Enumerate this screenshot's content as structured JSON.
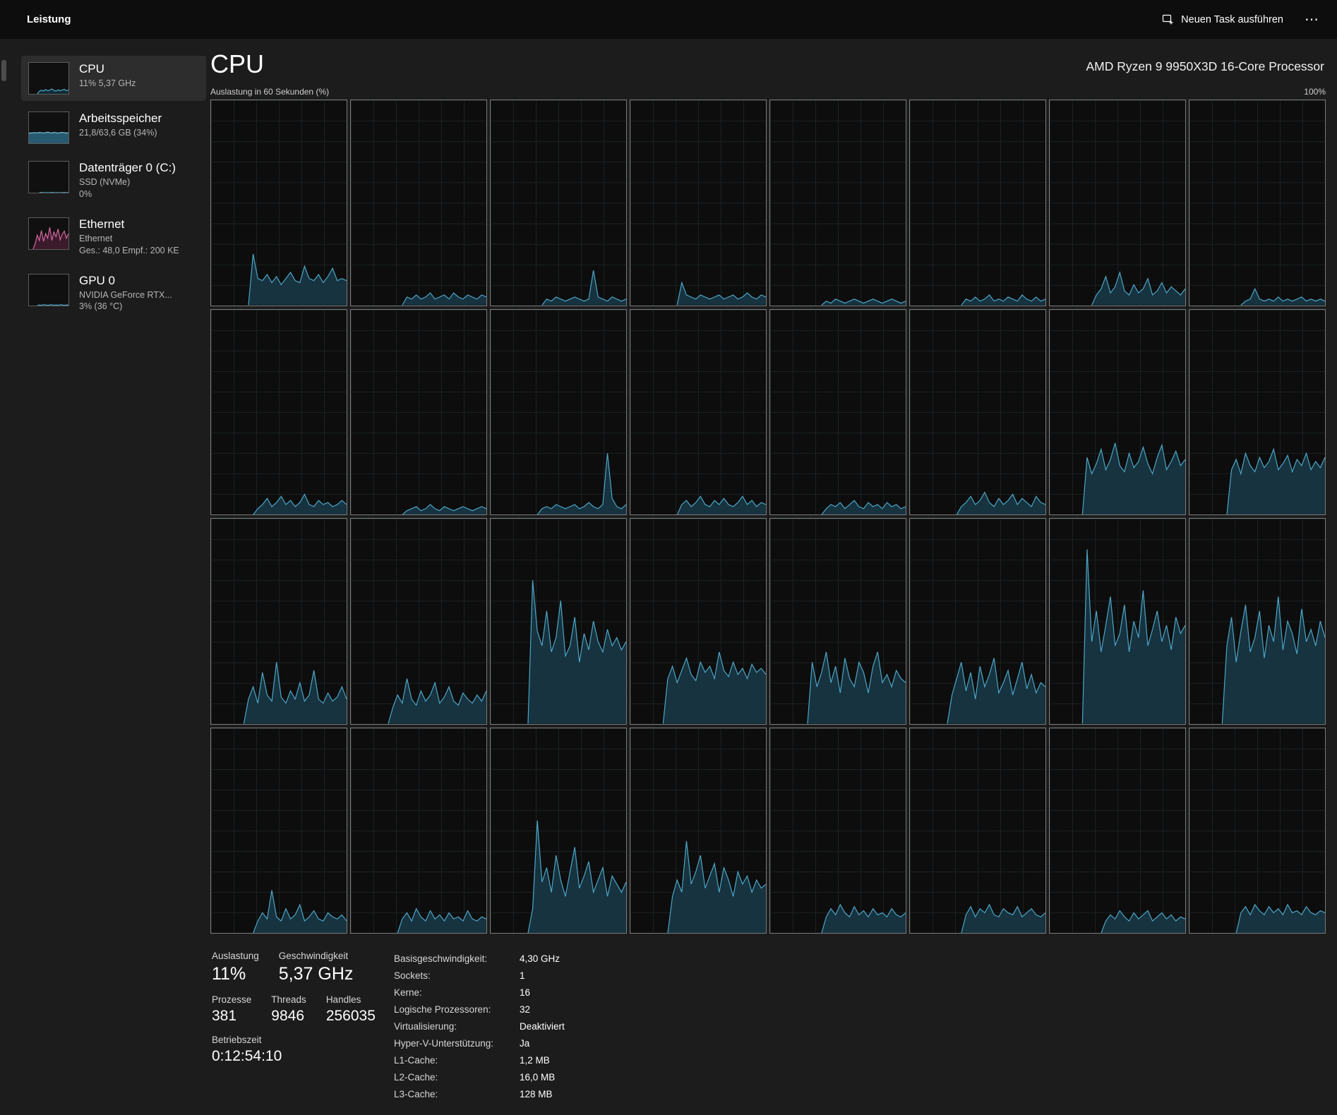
{
  "header": {
    "title": "Leistung",
    "run_task_label": "Neuen Task ausführen",
    "more_label": "⋯"
  },
  "sidebar": {
    "items": [
      {
        "id": "cpu",
        "title": "CPU",
        "line1": "11%  5,37 GHz"
      },
      {
        "id": "memory",
        "title": "Arbeitsspeicher",
        "line1": "21,8/63,6 GB (34%)"
      },
      {
        "id": "disk",
        "title": "Datenträger 0 (C:)",
        "line1": "SSD (NVMe)",
        "line2": "0%"
      },
      {
        "id": "ethernet",
        "title": "Ethernet",
        "line1": "Ethernet",
        "line2": "Ges.: 48,0 Empf.: 200 KE"
      },
      {
        "id": "gpu",
        "title": "GPU 0",
        "line1": "NVIDIA GeForce RTX...",
        "line2": "3% (36 °C)"
      }
    ]
  },
  "main": {
    "title": "CPU",
    "subtitle": "AMD Ryzen 9 9950X3D 16-Core Processor",
    "chart_header_left": "Auslastung in 60 Sekunden (%)",
    "chart_header_right": "100%"
  },
  "stats": {
    "utilization_label": "Auslastung",
    "utilization_value": "11%",
    "speed_label": "Geschwindigkeit",
    "speed_value": "5,37 GHz",
    "processes_label": "Prozesse",
    "processes_value": "381",
    "threads_label": "Threads",
    "threads_value": "9846",
    "handles_label": "Handles",
    "handles_value": "256035",
    "uptime_label": "Betriebszeit",
    "uptime_value": "0:12:54:10"
  },
  "details": [
    {
      "label": "Basisgeschwindigkeit:",
      "value": "4,30 GHz"
    },
    {
      "label": "Sockets:",
      "value": "1"
    },
    {
      "label": "Kerne:",
      "value": "16"
    },
    {
      "label": "Logische Prozessoren:",
      "value": "32"
    },
    {
      "label": "Virtualisierung:",
      "value": "Deaktiviert"
    },
    {
      "label": "Hyper-V-Unterstützung:",
      "value": "Ja"
    },
    {
      "label": "L1-Cache:",
      "value": "1,2 MB"
    },
    {
      "label": "L2-Cache:",
      "value": "16,0 MB"
    },
    {
      "label": "L3-Cache:",
      "value": "128 MB"
    }
  ],
  "colors": {
    "accent": "#4da6c8",
    "graph_stroke": "#4da6c8",
    "graph_fill": "#16333f",
    "chart_border": "#7a7a7a",
    "ethernet_accent": "#d4679e"
  },
  "chart_data": {
    "type": "area",
    "title": "Auslastung in 60 Sekunden (%)",
    "unit": "%",
    "ylim": [
      0,
      100
    ],
    "x_window_seconds": 60,
    "legend": "one area series per logical processor (32 total, row-major)",
    "cores": [
      [
        0,
        0,
        0,
        0,
        0,
        0,
        0,
        0,
        0,
        25,
        13,
        12,
        15,
        11,
        14,
        10,
        13,
        16,
        12,
        11,
        19,
        13,
        12,
        15,
        11,
        14,
        18,
        12,
        13,
        12
      ],
      [
        0,
        0,
        0,
        0,
        0,
        0,
        0,
        0,
        0,
        0,
        0,
        0,
        4,
        3,
        5,
        3,
        4,
        6,
        3,
        4,
        5,
        3,
        6,
        4,
        3,
        5,
        4,
        3,
        5,
        4
      ],
      [
        0,
        0,
        0,
        0,
        0,
        0,
        0,
        0,
        0,
        0,
        0,
        0,
        3,
        2,
        4,
        3,
        2,
        3,
        4,
        3,
        2,
        3,
        17,
        4,
        3,
        2,
        4,
        3,
        2,
        3
      ],
      [
        0,
        0,
        0,
        0,
        0,
        0,
        0,
        0,
        0,
        0,
        0,
        11,
        5,
        4,
        3,
        5,
        4,
        3,
        4,
        5,
        3,
        4,
        5,
        3,
        4,
        6,
        4,
        3,
        5,
        4
      ],
      [
        0,
        0,
        0,
        0,
        0,
        0,
        0,
        0,
        0,
        0,
        0,
        0,
        2,
        1,
        3,
        2,
        1,
        2,
        3,
        2,
        1,
        2,
        3,
        2,
        1,
        2,
        3,
        2,
        1,
        2
      ],
      [
        0,
        0,
        0,
        0,
        0,
        0,
        0,
        0,
        0,
        0,
        0,
        0,
        3,
        2,
        4,
        2,
        3,
        5,
        2,
        3,
        2,
        4,
        3,
        2,
        5,
        3,
        2,
        4,
        2,
        3
      ],
      [
        0,
        0,
        0,
        0,
        0,
        0,
        0,
        0,
        0,
        0,
        5,
        8,
        14,
        6,
        9,
        16,
        7,
        5,
        10,
        6,
        8,
        13,
        5,
        7,
        11,
        6,
        9,
        7,
        5,
        8
      ],
      [
        0,
        0,
        0,
        0,
        0,
        0,
        0,
        0,
        0,
        0,
        0,
        0,
        2,
        3,
        8,
        3,
        2,
        3,
        2,
        4,
        2,
        3,
        2,
        3,
        4,
        2,
        3,
        2,
        3,
        2
      ],
      [
        0,
        0,
        0,
        0,
        0,
        0,
        0,
        0,
        0,
        0,
        3,
        5,
        8,
        4,
        6,
        9,
        5,
        7,
        4,
        6,
        10,
        5,
        4,
        7,
        5,
        6,
        4,
        5,
        7,
        5
      ],
      [
        0,
        0,
        0,
        0,
        0,
        0,
        0,
        0,
        0,
        0,
        0,
        0,
        2,
        3,
        4,
        2,
        3,
        5,
        3,
        2,
        4,
        3,
        2,
        3,
        4,
        3,
        2,
        3,
        4,
        3
      ],
      [
        0,
        0,
        0,
        0,
        0,
        0,
        0,
        0,
        0,
        0,
        0,
        3,
        4,
        3,
        5,
        4,
        3,
        4,
        5,
        3,
        4,
        6,
        4,
        3,
        5,
        30,
        8,
        4,
        3,
        5
      ],
      [
        0,
        0,
        0,
        0,
        0,
        0,
        0,
        0,
        0,
        0,
        0,
        5,
        7,
        4,
        6,
        9,
        5,
        4,
        7,
        5,
        8,
        5,
        4,
        6,
        9,
        5,
        7,
        4,
        6,
        5
      ],
      [
        0,
        0,
        0,
        0,
        0,
        0,
        0,
        0,
        0,
        0,
        0,
        0,
        3,
        5,
        4,
        6,
        3,
        5,
        7,
        4,
        3,
        6,
        4,
        5,
        3,
        6,
        4,
        5,
        3,
        4
      ],
      [
        0,
        0,
        0,
        0,
        0,
        0,
        0,
        0,
        0,
        0,
        0,
        4,
        6,
        9,
        5,
        7,
        11,
        6,
        4,
        8,
        5,
        7,
        10,
        5,
        8,
        6,
        4,
        9,
        6,
        5
      ],
      [
        0,
        0,
        0,
        0,
        0,
        0,
        0,
        0,
        28,
        20,
        25,
        32,
        22,
        27,
        35,
        24,
        21,
        30,
        23,
        26,
        33,
        25,
        20,
        28,
        34,
        22,
        26,
        31,
        24,
        27
      ],
      [
        0,
        0,
        0,
        0,
        0,
        0,
        0,
        0,
        0,
        22,
        27,
        20,
        30,
        24,
        21,
        28,
        23,
        26,
        32,
        22,
        25,
        29,
        21,
        27,
        24,
        30,
        22,
        26,
        23,
        28
      ],
      [
        0,
        0,
        0,
        0,
        0,
        0,
        0,
        0,
        12,
        18,
        10,
        25,
        14,
        11,
        30,
        13,
        10,
        16,
        12,
        20,
        11,
        14,
        26,
        12,
        10,
        15,
        11,
        13,
        18,
        12
      ],
      [
        0,
        0,
        0,
        0,
        0,
        0,
        0,
        0,
        0,
        8,
        14,
        10,
        22,
        12,
        9,
        16,
        11,
        14,
        20,
        10,
        13,
        18,
        11,
        9,
        15,
        12,
        10,
        14,
        11,
        16
      ],
      [
        0,
        0,
        0,
        0,
        0,
        0,
        0,
        0,
        0,
        70,
        45,
        38,
        55,
        35,
        42,
        60,
        33,
        38,
        52,
        30,
        44,
        36,
        50,
        40,
        35,
        46,
        38,
        42,
        36,
        40
      ],
      [
        0,
        0,
        0,
        0,
        0,
        0,
        0,
        0,
        22,
        28,
        20,
        26,
        32,
        24,
        21,
        30,
        25,
        28,
        22,
        35,
        26,
        23,
        30,
        24,
        27,
        22,
        29,
        25,
        27,
        24
      ],
      [
        0,
        0,
        0,
        0,
        0,
        0,
        0,
        0,
        0,
        30,
        18,
        25,
        35,
        20,
        28,
        15,
        32,
        22,
        18,
        30,
        25,
        15,
        28,
        35,
        20,
        24,
        18,
        26,
        22,
        20
      ],
      [
        0,
        0,
        0,
        0,
        0,
        0,
        0,
        0,
        0,
        14,
        22,
        30,
        16,
        25,
        12,
        28,
        18,
        24,
        32,
        15,
        20,
        26,
        14,
        22,
        30,
        17,
        24,
        15,
        20,
        18
      ],
      [
        0,
        0,
        0,
        0,
        0,
        0,
        0,
        0,
        85,
        40,
        55,
        35,
        48,
        62,
        38,
        44,
        58,
        35,
        50,
        42,
        65,
        38,
        46,
        55,
        40,
        48,
        36,
        52,
        44,
        48
      ],
      [
        0,
        0,
        0,
        0,
        0,
        0,
        0,
        0,
        38,
        52,
        30,
        45,
        58,
        35,
        42,
        55,
        32,
        48,
        40,
        62,
        36,
        50,
        44,
        34,
        56,
        40,
        46,
        38,
        50,
        42
      ],
      [
        0,
        0,
        0,
        0,
        0,
        0,
        0,
        0,
        0,
        0,
        6,
        10,
        7,
        21,
        8,
        6,
        12,
        7,
        9,
        14,
        6,
        8,
        11,
        7,
        6,
        10,
        8,
        7,
        9,
        6
      ],
      [
        0,
        0,
        0,
        0,
        0,
        0,
        0,
        0,
        0,
        0,
        0,
        7,
        10,
        6,
        12,
        8,
        6,
        11,
        7,
        9,
        6,
        10,
        7,
        8,
        6,
        11,
        7,
        6,
        8,
        7
      ],
      [
        0,
        0,
        0,
        0,
        0,
        0,
        0,
        0,
        0,
        12,
        55,
        25,
        32,
        20,
        38,
        26,
        18,
        30,
        42,
        22,
        28,
        35,
        20,
        26,
        32,
        18,
        28,
        24,
        20,
        25
      ],
      [
        0,
        0,
        0,
        0,
        0,
        0,
        0,
        0,
        0,
        18,
        26,
        20,
        45,
        24,
        30,
        38,
        22,
        28,
        34,
        20,
        32,
        26,
        18,
        30,
        24,
        28,
        20,
        26,
        22,
        24
      ],
      [
        0,
        0,
        0,
        0,
        0,
        0,
        0,
        0,
        0,
        0,
        0,
        0,
        8,
        12,
        9,
        14,
        10,
        8,
        13,
        9,
        11,
        8,
        12,
        9,
        10,
        8,
        12,
        9,
        8,
        10
      ],
      [
        0,
        0,
        0,
        0,
        0,
        0,
        0,
        0,
        0,
        0,
        0,
        0,
        9,
        13,
        8,
        12,
        10,
        14,
        9,
        8,
        12,
        10,
        9,
        13,
        8,
        10,
        12,
        9,
        8,
        10
      ],
      [
        0,
        0,
        0,
        0,
        0,
        0,
        0,
        0,
        0,
        0,
        0,
        0,
        6,
        9,
        7,
        11,
        8,
        6,
        10,
        7,
        9,
        11,
        6,
        8,
        10,
        7,
        9,
        6,
        8,
        7
      ],
      [
        0,
        0,
        0,
        0,
        0,
        0,
        0,
        0,
        0,
        0,
        0,
        10,
        13,
        9,
        14,
        11,
        9,
        13,
        10,
        12,
        9,
        14,
        10,
        11,
        9,
        13,
        10,
        9,
        11,
        10
      ]
    ],
    "sidebar_sparks": {
      "cpu": {
        "stroke": "#4da6c8",
        "fill": "#122b35",
        "values": [
          0,
          0,
          0,
          0,
          0,
          8,
          12,
          9,
          14,
          10,
          12,
          16,
          11,
          9,
          13,
          10,
          12,
          15,
          10,
          13
        ]
      },
      "memory": {
        "stroke": "#7ec3de",
        "fill": "#275a70",
        "values": [
          33,
          33,
          34,
          34,
          33,
          35,
          34,
          33,
          34,
          36,
          34,
          33,
          35,
          34,
          33,
          34,
          35,
          34,
          33,
          34
        ]
      },
      "disk": {
        "stroke": "#4da6c8",
        "fill": "#122b35",
        "values": [
          0,
          0,
          0,
          0,
          0,
          0,
          1,
          0,
          0,
          0,
          0,
          1,
          0,
          0,
          0,
          0,
          0,
          1,
          0,
          0
        ]
      },
      "ethernet": {
        "stroke": "#d4679e",
        "fill": "#3a1a2b",
        "values": [
          0,
          0,
          0,
          18,
          45,
          28,
          60,
          25,
          50,
          35,
          70,
          28,
          55,
          40,
          65,
          30,
          48,
          58,
          35,
          50
        ]
      },
      "gpu": {
        "stroke": "#4da6c8",
        "fill": "#122b35",
        "values": [
          0,
          0,
          0,
          0,
          0,
          2,
          1,
          3,
          2,
          1,
          2,
          3,
          1,
          2,
          1,
          3,
          2,
          1,
          2,
          2
        ]
      }
    }
  }
}
